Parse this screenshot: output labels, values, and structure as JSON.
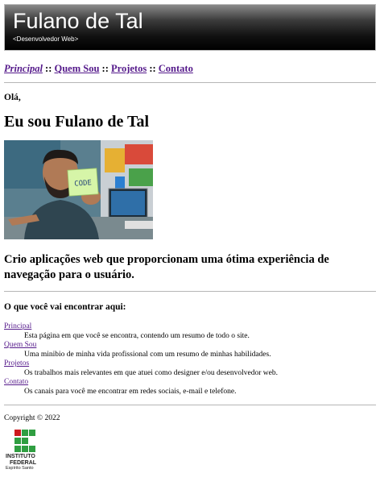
{
  "header": {
    "title": "Fulano de Tal",
    "subtitle": "<Desenvolvedor Web>"
  },
  "nav": {
    "items": [
      {
        "label": "Principal"
      },
      {
        "label": "Quem Sou"
      },
      {
        "label": "Projetos"
      },
      {
        "label": "Contato"
      }
    ],
    "separator": "::"
  },
  "main": {
    "greeting": "Olá,",
    "heading": "Eu sou Fulano de Tal",
    "photo_caption": "CODE",
    "tagline": "Crio aplicações web que proporcionam uma ótima experiência de navegação para o usuário.",
    "section_title": "O que você vai encontrar aqui:",
    "definitions": [
      {
        "term": "Principal",
        "desc": "Esta página em que você se encontra, contendo um resumo de todo o site."
      },
      {
        "term": "Quem Sou",
        "desc": "Uma minibio de minha vida profissional com um resumo de minhas habilidades."
      },
      {
        "term": "Projetos",
        "desc": "Os trabalhos mais relevantes em que atuei como designer e/ou desenvolvedor web."
      },
      {
        "term": "Contato",
        "desc": "Os canais para você me encontrar em redes sociais, e-mail e telefone."
      }
    ]
  },
  "footer": {
    "copyright": "Copyright © 2022",
    "logo_line1": "INSTITUTO",
    "logo_line2": "FEDERAL",
    "logo_line3": "Espírito Santo",
    "logo_colors": {
      "green": "#2f9e41",
      "red": "#cd191e"
    }
  }
}
